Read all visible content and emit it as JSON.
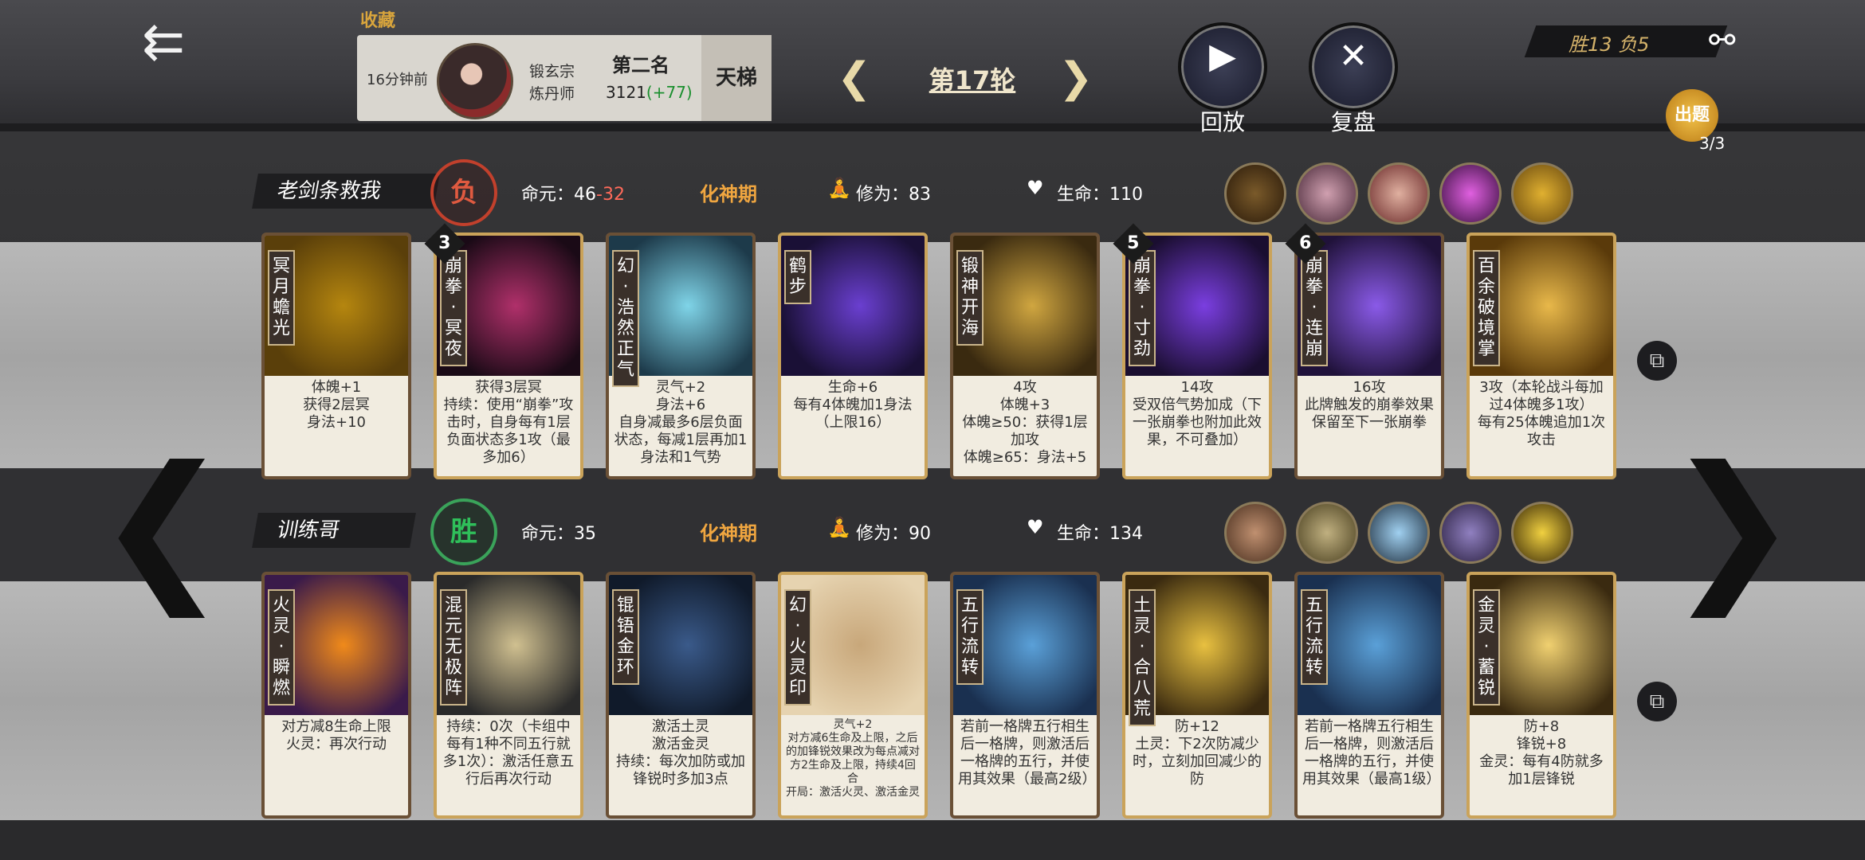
{
  "header": {
    "back_icon": "double-arrow-left-icon",
    "favorite_label": "收藏",
    "record": {
      "time": "16分钟前",
      "sect": "锻玄宗",
      "profession": "炼丹师",
      "rank": "第二名",
      "score": "3121",
      "score_delta": "(+77)",
      "tab": "天梯"
    },
    "round_label": "第17轮",
    "replay_label": "回放",
    "review_label": "复盘",
    "win_loss": "胜13  负5",
    "quiz_label": "出题",
    "quiz_count": "3/3"
  },
  "players": [
    {
      "name": "老剑条救我",
      "result": "负",
      "life_label": "命元：",
      "life_value": "46",
      "life_delta": "-32",
      "realm": "化神期",
      "cultivation_label": "修为：",
      "cultivation_value": "83",
      "hp_label": "生命：",
      "hp_value": "110",
      "cards": [
        {
          "title": "冥月蟾光",
          "desc": "体魄+1\n获得2层冥\n身法+10",
          "colors": [
            "#b5860f",
            "#5a3f0a"
          ]
        },
        {
          "title": "崩拳·冥夜",
          "badge": "3",
          "desc": "获得3层冥\n持续：使用“崩拳”攻击时，自身每有1层负面状态多1攻（最多加6）",
          "colors": [
            "#b0306a",
            "#1a0a16"
          ]
        },
        {
          "title": "幻·浩然正气",
          "desc": "灵气+2\n身法+6\n自身减最多6层负面状态，每减1层再加1身法和1气势",
          "colors": [
            "#7fd4e8",
            "#1d3a4a"
          ]
        },
        {
          "title": "鹤步",
          "desc": "生命+6\n每有4体魄加1身法（上限16）",
          "colors": [
            "#6a3fd0",
            "#1a1036"
          ]
        },
        {
          "title": "锻神开海",
          "desc": "4攻\n体魄+3\n体魄≥50：获得1层加攻\n体魄≥65：身法+5",
          "colors": [
            "#d0a640",
            "#3a2a10"
          ]
        },
        {
          "title": "崩拳·寸劲",
          "badge": "5",
          "desc": "14攻\n受双倍气势加成（下一张崩拳也附加此效果，不可叠加）",
          "colors": [
            "#7a3ee0",
            "#1a0e30"
          ]
        },
        {
          "title": "崩拳·连崩",
          "badge": "6",
          "desc": "16攻\n此牌触发的崩拳效果保留至下一张崩拳",
          "colors": [
            "#8a5ae8",
            "#20123a"
          ]
        },
        {
          "title": "百余破境掌",
          "desc": "3攻（本轮战斗每加过4体魄多1攻）\n每有25体魄追加1次攻击",
          "colors": [
            "#e8b84a",
            "#5a3a0a"
          ]
        }
      ]
    },
    {
      "name": "训练哥",
      "result": "胜",
      "life_label": "命元：",
      "life_value": "35",
      "realm": "化神期",
      "cultivation_label": "修为：",
      "cultivation_value": "90",
      "hp_label": "生命：",
      "hp_value": "134",
      "cards": [
        {
          "title": "火灵·瞬燃",
          "desc": "对方减8生命上限\n火灵：再次行动",
          "colors": [
            "#f08a1a",
            "#3a1a4a"
          ]
        },
        {
          "title": "混元无极阵",
          "desc": "持续：0次（卡组中每有1种不同五行就多1次）：激活任意五行后再次行动",
          "colors": [
            "#d0c090",
            "#2a2a2a"
          ]
        },
        {
          "title": "锟铻金环",
          "desc": "激活土灵\n激活金灵\n持续：每次加防或加锋锐时多加3点",
          "colors": [
            "#3a5a8a",
            "#101a2a"
          ]
        },
        {
          "title": "幻·火灵印",
          "desc": "灵气+2\n对方减6生命及上限，之后的加锋锐效果改为每点减对方2生命及上限，持续4回合\n开局：激活火灵、激活金灵",
          "colors": [
            "#c8a77a",
            "#e6d3b0"
          ]
        },
        {
          "title": "五行流转",
          "desc": "若前一格牌五行相生后一格牌，则激活后一格牌的五行，并使用其效果（最高2级）",
          "colors": [
            "#5aa0d8",
            "#1a3050"
          ]
        },
        {
          "title": "土灵·合八荒",
          "desc": "防+12\n土灵：下2次防减少时，立刻加回减少的防",
          "colors": [
            "#e8c040",
            "#3a2a10"
          ]
        },
        {
          "title": "五行流转",
          "desc": "若前一格牌五行相生后一格牌，则激活后一格牌的五行，并使用其效果（最高1级）",
          "colors": [
            "#5aa0d8",
            "#1a3050"
          ]
        },
        {
          "title": "金灵·蓄锐",
          "desc": "防+8\n锋锐+8\n金灵：每有4防就多加1层锋锐",
          "colors": [
            "#f0d070",
            "#3a2a10"
          ]
        }
      ]
    }
  ],
  "icons": {
    "meditate": "meditation-icon",
    "hp": "heart-flame-icon",
    "copy": "copy-icon",
    "share": "share-icon"
  },
  "colors": {
    "accent_gold": "#d9a53c",
    "lose_red": "#c2402c",
    "win_green": "#3aa35a",
    "delta_green": "#1a8f2e"
  }
}
